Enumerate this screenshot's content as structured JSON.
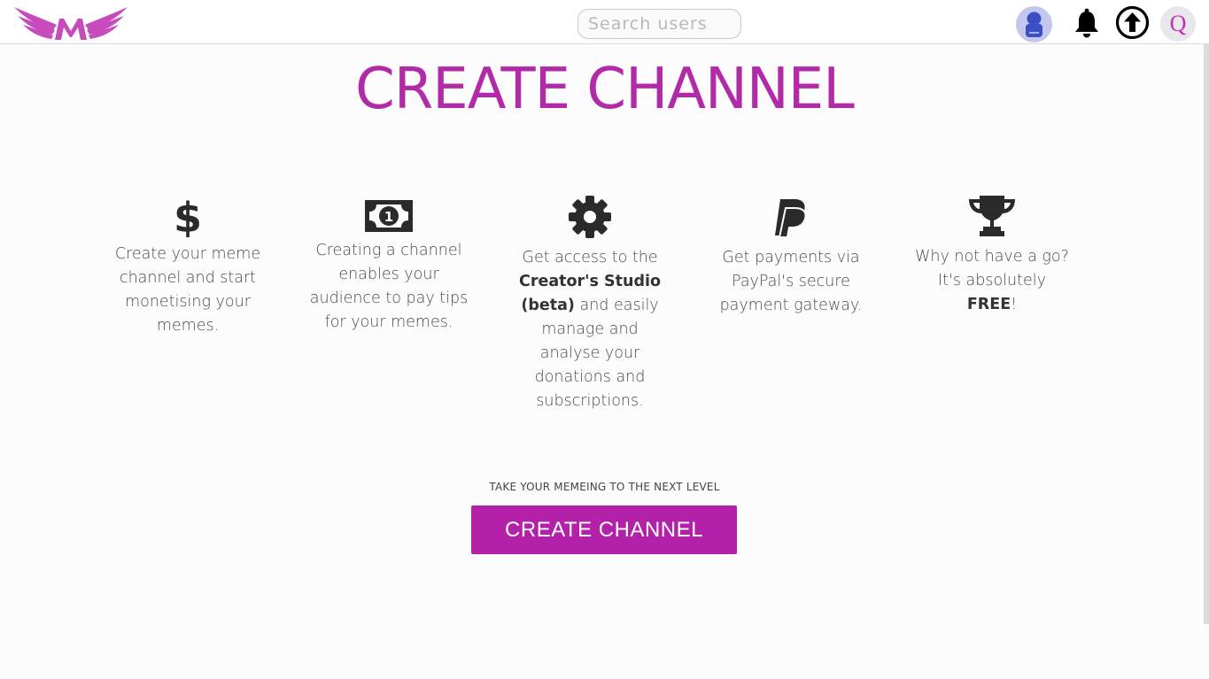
{
  "header": {
    "search_placeholder": "Search users",
    "profile_initial": "Q"
  },
  "icons": {
    "logo": "winged-m-logo",
    "bell": "bell-icon",
    "upload": "upload-arrow-icon",
    "avatar": "user-avatar"
  },
  "colors": {
    "brand": "#b321a9",
    "title": "#b12ba8",
    "logo": "#c84bbd",
    "text": "#4a4a4a"
  },
  "page": {
    "title": "CREATE CHANNEL",
    "tagline": "TAKE YOUR MEMEING TO THE NEXT LEVEL",
    "cta_label": "CREATE CHANNEL"
  },
  "features": [
    {
      "icon": "dollar-icon",
      "text_a": "Create your meme channel and start monetising your memes."
    },
    {
      "icon": "banknote-icon",
      "text_a": "Creating a channel enables your audience to pay tips for your memes."
    },
    {
      "icon": "gear-icon",
      "text_a": "Get access to the",
      "bold": "Creator's Studio (beta)",
      "text_b": "and easily manage and analyse your donations and subscriptions."
    },
    {
      "icon": "paypal-icon",
      "text_a": "Get payments via PayPal's secure payment gateway."
    },
    {
      "icon": "trophy-icon",
      "text_a": "Why not have a go? It's absolutely",
      "bold": "FREE",
      "text_b": "!"
    }
  ]
}
